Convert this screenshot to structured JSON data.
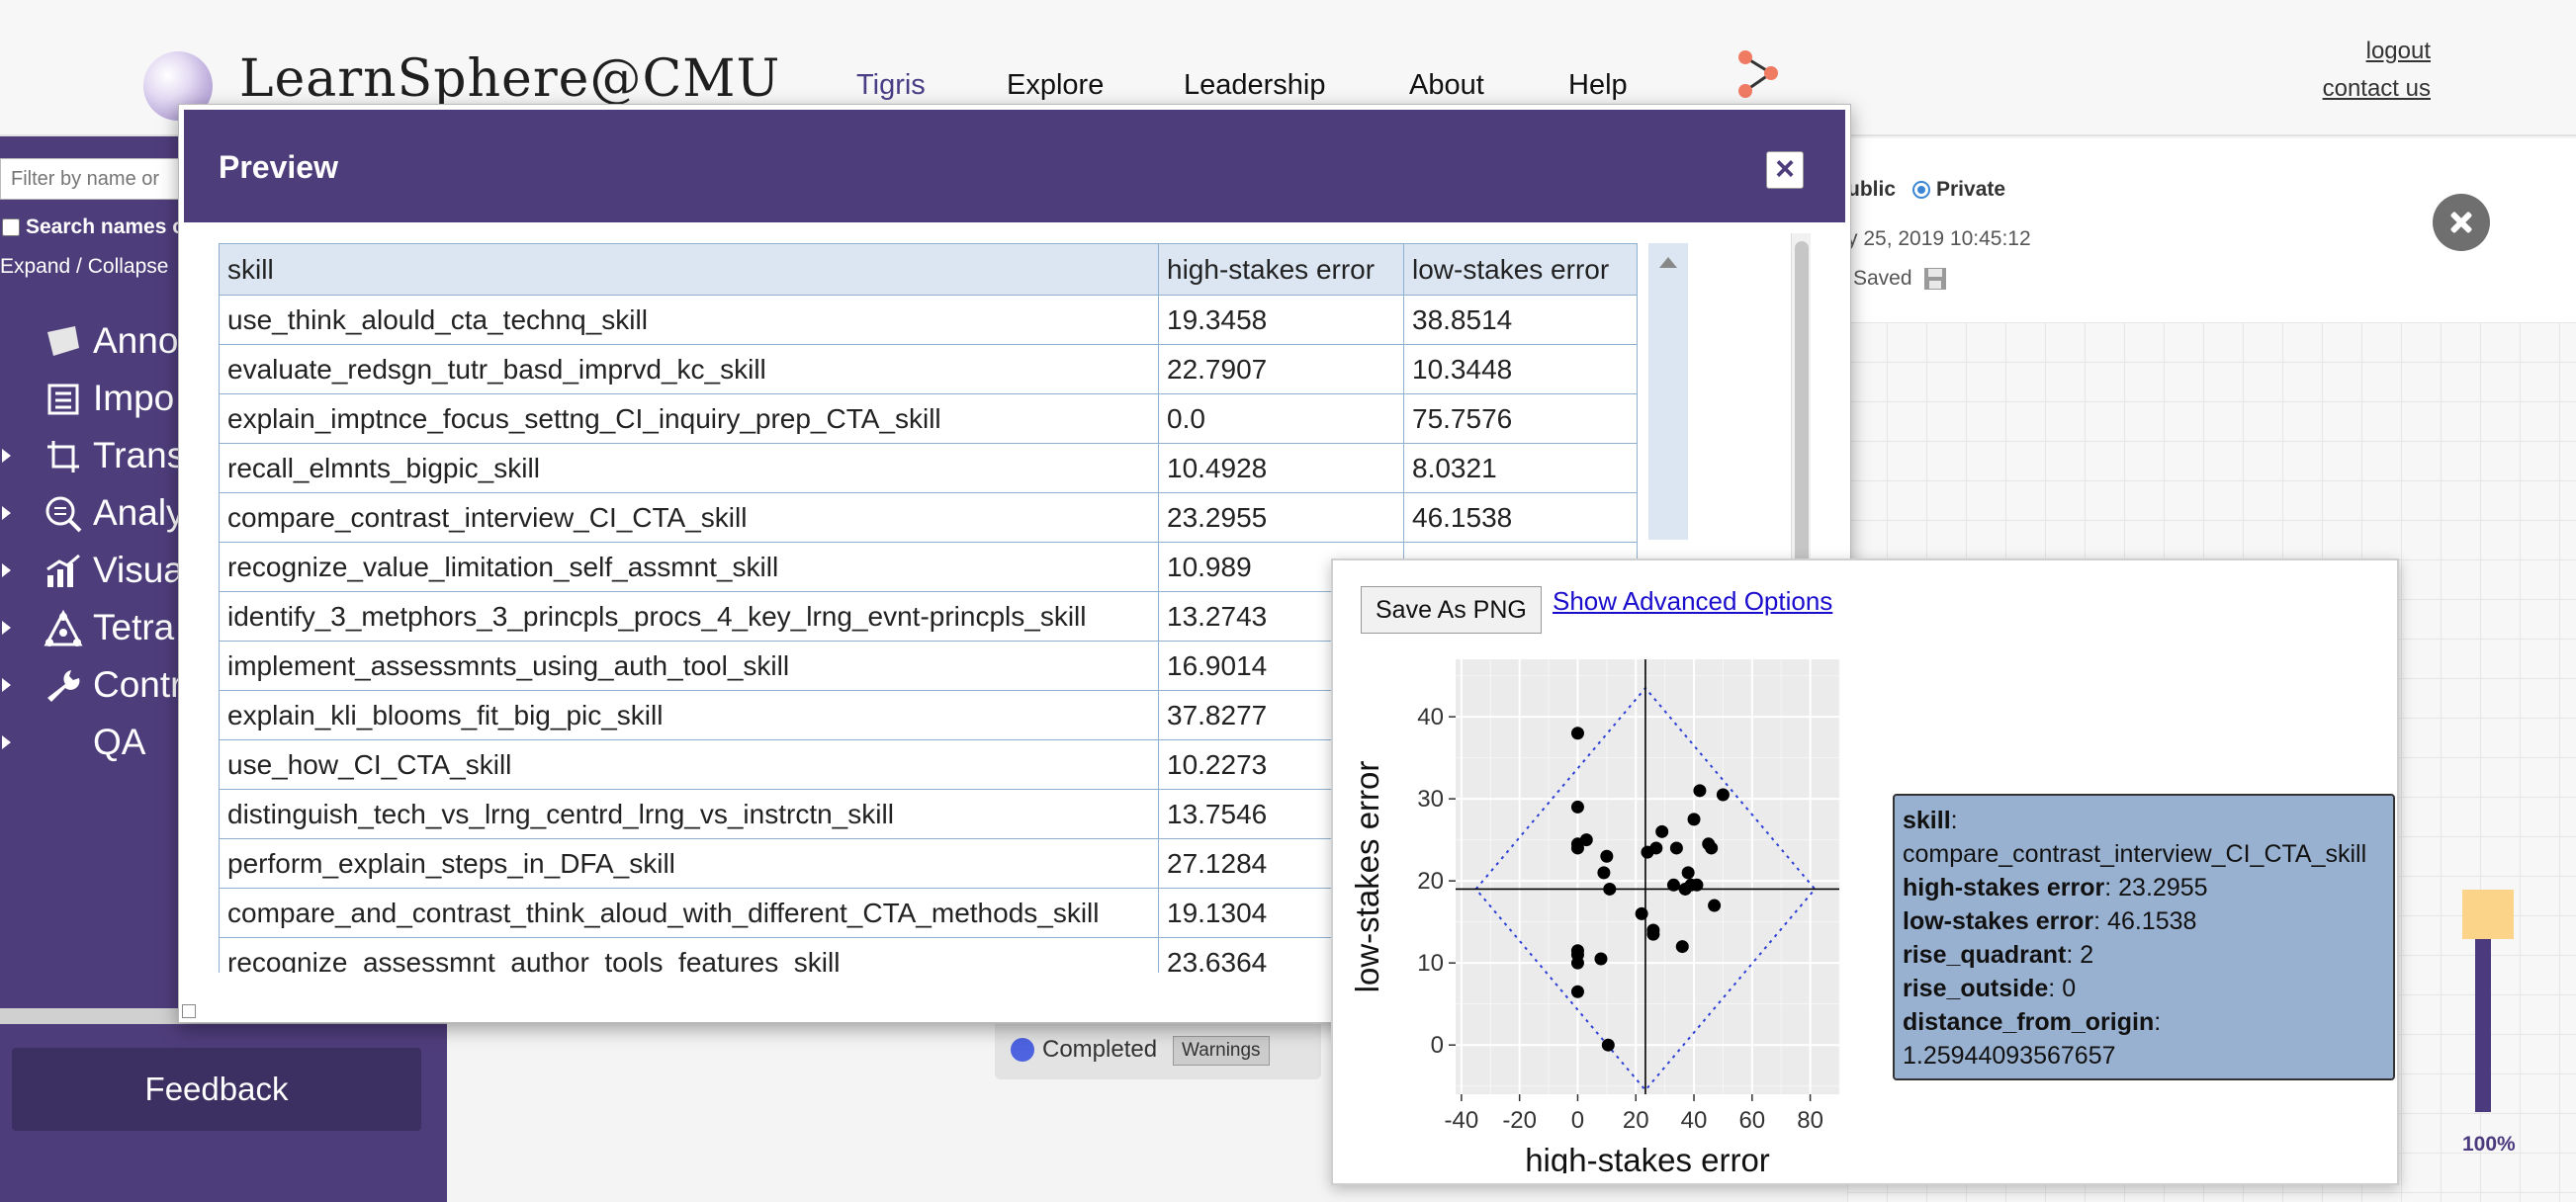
{
  "header": {
    "brand": "LearnSphere@CMU",
    "nav": [
      {
        "label": "Tigris",
        "active": true
      },
      {
        "label": "Explore",
        "active": false
      },
      {
        "label": "Leadership",
        "active": false
      },
      {
        "label": "About",
        "active": false
      },
      {
        "label": "Help",
        "active": false
      }
    ],
    "logout": "logout",
    "contact": "contact us"
  },
  "sidebar": {
    "filter_placeholder": "Filter by name or",
    "search_names_label": "Search names c",
    "expand_collapse": "Expand / Collapse",
    "items": [
      {
        "label": "Anno",
        "icon": "annotation-icon"
      },
      {
        "label": "Impo",
        "icon": "import-icon"
      },
      {
        "label": "Trans",
        "icon": "transform-icon"
      },
      {
        "label": "Analy",
        "icon": "analysis-icon"
      },
      {
        "label": "Visua",
        "icon": "visualization-icon"
      },
      {
        "label": "Tetra",
        "icon": "tetrad-icon"
      },
      {
        "label": "Contr",
        "icon": "wrench-icon"
      },
      {
        "label": "QA",
        "icon": ""
      }
    ],
    "feedback": "Feedback"
  },
  "background": {
    "visibility_public": "ublic",
    "visibility_private": "Private",
    "date": "y 25, 2019 10:45:12",
    "saved": "Saved",
    "status": "Completed",
    "warnings": "Warnings",
    "zoom": "100%"
  },
  "preview": {
    "title": "Preview",
    "close": "×",
    "columns": [
      "skill",
      "high-stakes error",
      "low-stakes error"
    ],
    "rows": [
      [
        "use_think_alould_cta_technq_skill",
        "19.3458",
        "38.8514"
      ],
      [
        "evaluate_redsgn_tutr_basd_imprvd_kc_skill",
        "22.7907",
        "10.3448"
      ],
      [
        "explain_imptnce_focus_settng_CI_inquiry_prep_CTA_skill",
        "0.0",
        "75.7576"
      ],
      [
        "recall_elmnts_bigpic_skill",
        "10.4928",
        "8.0321"
      ],
      [
        "compare_contrast_interview_CI_CTA_skill",
        "23.2955",
        "46.1538"
      ],
      [
        "recognize_value_limitation_self_assmnt_skill",
        "10.989",
        ""
      ],
      [
        "identify_3_metphors_3_princpls_procs_4_key_lrng_evnt-princpls_skill",
        "13.2743",
        ""
      ],
      [
        "implement_assessmnts_using_auth_tool_skill",
        "16.9014",
        ""
      ],
      [
        "explain_kli_blooms_fit_big_pic_skill",
        "37.8277",
        ""
      ],
      [
        "use_how_CI_CTA_skill",
        "10.2273",
        ""
      ],
      [
        "distinguish_tech_vs_lrng_centrd_lrng_vs_instrctn_skill",
        "13.7546",
        ""
      ],
      [
        "perform_explain_steps_in_DFA_skill",
        "27.1284",
        ""
      ],
      [
        "compare_and_contrast_think_aloud_with_different_CTA_methods_skill",
        "19.1304",
        ""
      ],
      [
        "recognize_assessmnt_author_tools_features_skill",
        "23.6364",
        ""
      ]
    ]
  },
  "chart_window": {
    "save_png": "Save As PNG",
    "advanced": "Show Advanced Options",
    "tooltip": {
      "skill_key": "skill",
      "skill_val": "compare_contrast_interview_CI_CTA_skill",
      "hs_key": "high-stakes error",
      "hs_val": "23.2955",
      "ls_key": "low-stakes error",
      "ls_val": "46.1538",
      "rq_key": "rise_quadrant",
      "rq_val": "2",
      "ro_key": "rise_outside",
      "ro_val": "0",
      "dist_key": "distance_from_origin",
      "dist_val": "1.25944093567657"
    }
  },
  "chart_data": {
    "type": "scatter",
    "xlabel": "high-stakes error",
    "ylabel": "low-stakes error",
    "x_ticks": [
      "-40",
      "-20",
      "0",
      "20",
      "40",
      "60",
      "80"
    ],
    "y_ticks": [
      "0",
      "10",
      "20",
      "30",
      "40"
    ],
    "xlim": [
      -42,
      90
    ],
    "ylim": [
      -6,
      47
    ],
    "vline": 23.3,
    "hline": 19,
    "diamond": [
      [
        -35,
        19
      ],
      [
        23.3,
        43.5
      ],
      [
        81.6,
        19
      ],
      [
        23.3,
        -5.5
      ]
    ],
    "points": [
      [
        0,
        38
      ],
      [
        0,
        29
      ],
      [
        0,
        24.5
      ],
      [
        0,
        24
      ],
      [
        0,
        11.5
      ],
      [
        0,
        11
      ],
      [
        0,
        10
      ],
      [
        0,
        6.5
      ],
      [
        3,
        25
      ],
      [
        8,
        10.5
      ],
      [
        9,
        21
      ],
      [
        10,
        23
      ],
      [
        11,
        19
      ],
      [
        10.5,
        0
      ],
      [
        22,
        16
      ],
      [
        24,
        23.5
      ],
      [
        26,
        14
      ],
      [
        26,
        13.5
      ],
      [
        27,
        24
      ],
      [
        29,
        26
      ],
      [
        33,
        19.5
      ],
      [
        34,
        24
      ],
      [
        36,
        12
      ],
      [
        37,
        19
      ],
      [
        38,
        21
      ],
      [
        39,
        19.5
      ],
      [
        40,
        27.5
      ],
      [
        41,
        19.5
      ],
      [
        42,
        31
      ],
      [
        45,
        24.5
      ],
      [
        46,
        24
      ],
      [
        47,
        17
      ],
      [
        50,
        30.5
      ]
    ],
    "colors": {
      "point": "#000000",
      "panel": "#ebebeb",
      "diamond": "#2b3fd6"
    }
  }
}
